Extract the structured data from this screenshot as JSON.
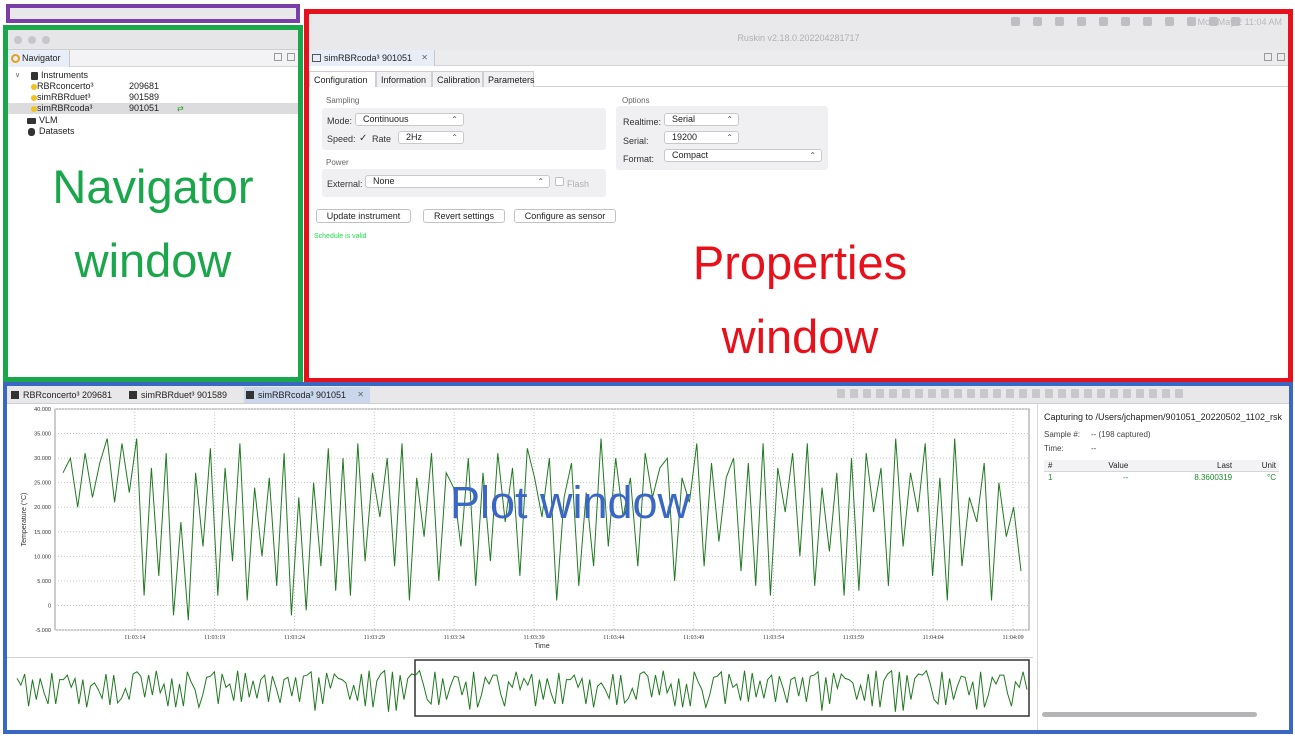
{
  "app": {
    "title": "Ruskin v2.18.0.202204281717",
    "clock": "Mon May 2 11:04 AM"
  },
  "navigator": {
    "tab_label": "Navigator",
    "tree": {
      "instruments_label": "Instruments",
      "items": [
        {
          "name": "RBRconcerto³",
          "serial": "209681"
        },
        {
          "name": "simRBRduet³",
          "serial": "901589"
        },
        {
          "name": "simRBRcoda³",
          "serial": "901051"
        }
      ],
      "vlm_label": "VLM",
      "datasets_label": "Datasets"
    },
    "annotation": "Navigator window"
  },
  "properties": {
    "tab_label": "simRBRcoda³ 901051",
    "tabs": [
      "Configuration",
      "Information",
      "Calibration",
      "Parameters"
    ],
    "sampling": {
      "title": "Sampling",
      "mode_label": "Mode:",
      "mode_value": "Continuous",
      "speed_label": "Speed:",
      "rate_label": "Rate",
      "rate_value": "2Hz"
    },
    "power": {
      "title": "Power",
      "external_label": "External:",
      "external_value": "None",
      "flash_label": "Flash"
    },
    "options": {
      "title": "Options",
      "realtime_label": "Realtime:",
      "realtime_value": "Serial",
      "serial_label": "Serial:",
      "serial_value": "19200",
      "format_label": "Format:",
      "format_value": "Compact"
    },
    "buttons": {
      "update": "Update instrument",
      "revert": "Revert settings",
      "configure": "Configure as sensor"
    },
    "schedule_status": "Schedule is valid",
    "annotation_line1": "Properties",
    "annotation_line2": "window"
  },
  "plot": {
    "tabs": [
      "RBRconcerto³ 209681",
      "simRBRduet³ 901589",
      "simRBRcoda³ 901051"
    ],
    "annotation": "Plot window",
    "capturing": "Capturing to /Users/jchapmen/901051_20220502_1102_rsk",
    "sample_label": "Sample #:",
    "sample_value": "-- (198 captured)",
    "time_label": "Time:",
    "time_value": "--",
    "stats_headers": [
      "#",
      "Value",
      "Last",
      "Unit"
    ],
    "stats_row": [
      "1",
      "--",
      "8.3600319",
      "°C"
    ]
  },
  "chart_data": {
    "type": "line",
    "ylabel": "Temperature (°C)",
    "xlabel": "Time",
    "y_ticks": [
      "40.000",
      "35.000",
      "30.000",
      "25.000",
      "20.000",
      "15.000",
      "10.000",
      "5.000",
      "0",
      "-5.000"
    ],
    "x_ticks": [
      "11:03:14",
      "11:03:19",
      "11:03:24",
      "11:03:29",
      "11:03:34",
      "11:03:39",
      "11:03:44",
      "11:03:49",
      "11:03:54",
      "11:03:59",
      "11:04:04",
      "11:04:09"
    ],
    "ylim": [
      -5,
      40
    ],
    "x_start_seconds": 9,
    "x_end_seconds": 70,
    "series_color": "#1f7a1f",
    "series": [
      {
        "values": [
          27,
          30,
          20,
          31,
          22,
          29,
          34,
          21,
          33,
          23,
          34,
          2,
          28,
          6,
          31,
          -2,
          17,
          -3,
          27,
          12,
          32,
          2,
          28,
          9,
          33,
          1,
          24,
          10,
          26,
          4,
          31,
          -2,
          22,
          -1,
          25,
          8,
          32,
          3,
          30,
          2,
          33,
          9,
          27,
          18,
          30,
          8,
          33,
          1,
          26,
          14,
          31,
          5,
          27,
          24,
          12,
          30,
          4,
          27,
          9,
          31,
          17,
          28,
          6,
          32,
          26,
          18,
          30,
          1,
          22,
          29,
          4,
          23,
          8,
          34,
          12,
          30,
          18,
          26,
          8,
          31,
          22,
          28,
          30,
          5,
          26,
          21,
          33,
          8,
          29,
          13,
          26,
          30,
          7,
          29,
          4,
          33,
          2,
          28,
          19,
          31,
          10,
          33,
          4,
          24,
          11,
          27,
          2,
          30,
          3,
          31,
          19,
          28,
          4,
          34,
          12,
          27,
          19,
          33,
          6,
          26,
          1,
          34,
          8,
          22,
          17,
          29,
          1,
          25,
          14,
          20,
          7
        ]
      }
    ]
  }
}
